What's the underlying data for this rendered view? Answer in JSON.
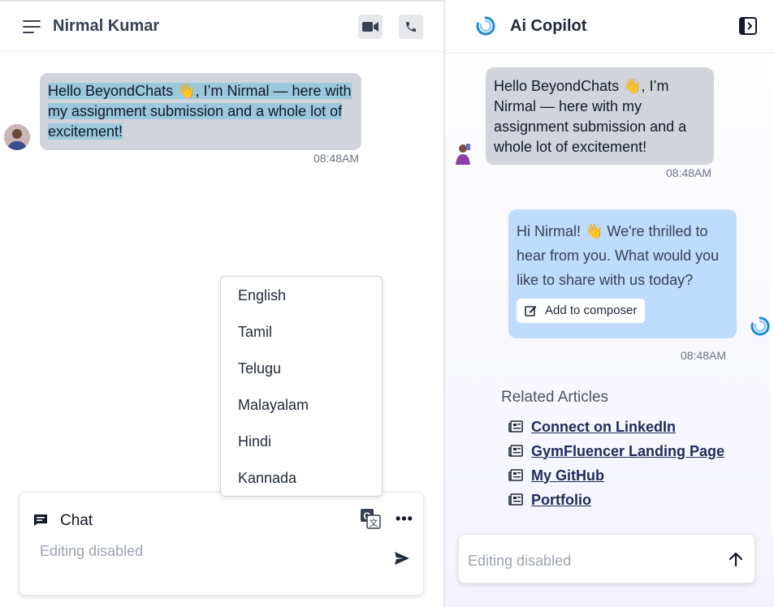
{
  "chat": {
    "contact_name": "Nirmal Kumar",
    "header_icons": [
      "menu-icon",
      "video-call-icon",
      "phone-call-icon"
    ],
    "message": {
      "text": "Hello BeyondChats 👋, I’m Nirmal — here with my assignment submission and a whole lot of excitement!",
      "time": "08:48AM"
    },
    "language_menu": {
      "options": [
        "English",
        "Tamil",
        "Telugu",
        "Malayalam",
        "Hindi",
        "Kannada"
      ]
    },
    "composer": {
      "mode_label": "Chat",
      "placeholder": "Editing disabled",
      "icons": [
        "chat-icon",
        "translate-icon",
        "more-icon",
        "send-icon"
      ]
    }
  },
  "copilot": {
    "title": "Ai Copilot",
    "user_message": {
      "text": "Hello BeyondChats 👋, I’m Nirmal — here with my assignment submission and a whole lot of excitement!",
      "time": "08:48AM"
    },
    "bot_message": {
      "text": "Hi Nirmal! 👋 We're thrilled to hear from you. What would you like to share with us today?",
      "action_label": "Add to composer",
      "time": "08:48AM"
    },
    "related": {
      "title": "Related Articles",
      "articles": [
        "Connect on LinkedIn",
        "GymFluencer Landing Page",
        "My GitHub",
        "Portfolio"
      ]
    },
    "input_placeholder": "Editing disabled"
  },
  "colors": {
    "user_bubble": "#d1d5db",
    "bot_bubble": "#bfdbfe",
    "text_highlight": "#9bc8dc",
    "copilot_brand": "#1d8ad8"
  }
}
